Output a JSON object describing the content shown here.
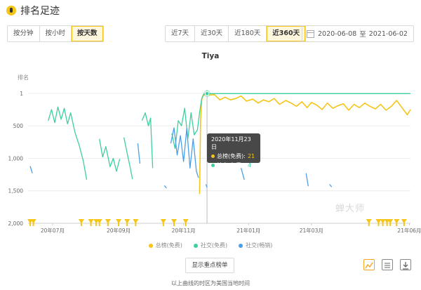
{
  "header": {
    "title": "排名足迹"
  },
  "granularity": {
    "options": [
      "按分钟",
      "按小时",
      "按天数"
    ],
    "active": 2
  },
  "ranges": {
    "options": [
      "近7天",
      "近30天",
      "近180天",
      "近360天"
    ],
    "active": 3
  },
  "date_range": {
    "start": "2020-06-08",
    "separator": "至",
    "end": "2021-06-02"
  },
  "tooltip": {
    "date": "2020年11月23日",
    "rows": [
      {
        "label": "总榜(免费):",
        "value": "21",
        "color": "#f5c518"
      },
      {
        "label": "社交(免费):",
        "value": "4",
        "color": "#3ecf9e"
      }
    ]
  },
  "show_button": "显示重点榜单",
  "footer": "以上曲线的时区为美国当地时间",
  "watermark": "蝉大师",
  "colors": {
    "total_free": "#f5c518",
    "social_free": "#3ecf9e",
    "social_paid": "#4a9fe8"
  },
  "chart_data": {
    "type": "line",
    "title": "Tiya",
    "ylabel": "排名",
    "y_ticks": [
      "1",
      "500",
      "1,000",
      "1,500",
      "2,000"
    ],
    "y_tick_values": [
      1,
      500,
      1000,
      1500,
      2000
    ],
    "ylim": [
      1,
      2000
    ],
    "y_inverted": true,
    "x_ticks": [
      "20年07月",
      "20年09月",
      "20年11月",
      "21年01月",
      "21年03月",
      "21年06月"
    ],
    "x_tick_dates": [
      "2020-07-01",
      "2020-09-01",
      "2020-11-01",
      "2021-01-01",
      "2021-03-01",
      "2021-06-01"
    ],
    "xlim": [
      "2020-06-08",
      "2021-06-02"
    ],
    "grid": true,
    "legend": "bottom",
    "series": [
      {
        "name": "总榜(免费)",
        "color": "#f5c518",
        "points": [
          [
            "2020-11-16",
            1550
          ],
          [
            "2020-11-17",
            400
          ],
          [
            "2020-11-18",
            100
          ],
          [
            "2020-11-19",
            40
          ],
          [
            "2020-11-21",
            20
          ],
          [
            "2020-11-23",
            21
          ],
          [
            "2020-11-26",
            25
          ],
          [
            "2020-11-30",
            20
          ],
          [
            "2020-12-05",
            100
          ],
          [
            "2020-12-10",
            60
          ],
          [
            "2020-12-15",
            100
          ],
          [
            "2020-12-20",
            80
          ],
          [
            "2020-12-25",
            40
          ],
          [
            "2020-12-30",
            120
          ],
          [
            "2021-01-05",
            90
          ],
          [
            "2021-01-10",
            150
          ],
          [
            "2021-01-15",
            100
          ],
          [
            "2021-01-20",
            130
          ],
          [
            "2021-01-25",
            80
          ],
          [
            "2021-01-30",
            170
          ],
          [
            "2021-02-05",
            110
          ],
          [
            "2021-02-10",
            150
          ],
          [
            "2021-02-15",
            200
          ],
          [
            "2021-02-20",
            130
          ],
          [
            "2021-02-25",
            220
          ],
          [
            "2021-03-01",
            140
          ],
          [
            "2021-03-06",
            180
          ],
          [
            "2021-03-11",
            250
          ],
          [
            "2021-03-16",
            150
          ],
          [
            "2021-03-21",
            230
          ],
          [
            "2021-03-26",
            190
          ],
          [
            "2021-03-31",
            160
          ],
          [
            "2021-04-05",
            260
          ],
          [
            "2021-04-10",
            170
          ],
          [
            "2021-04-15",
            220
          ],
          [
            "2021-04-20",
            150
          ],
          [
            "2021-04-25",
            200
          ],
          [
            "2021-04-30",
            240
          ],
          [
            "2021-05-05",
            170
          ],
          [
            "2021-05-10",
            260
          ],
          [
            "2021-05-15",
            200
          ],
          [
            "2021-05-20",
            110
          ],
          [
            "2021-05-25",
            220
          ],
          [
            "2021-05-30",
            330
          ],
          [
            "2021-06-02",
            250
          ]
        ]
      },
      {
        "name": "社交(免费)",
        "color": "#3ecf9e",
        "points": [
          [
            "2020-06-27",
            420
          ],
          [
            "2020-06-30",
            250
          ],
          [
            "2020-07-03",
            450
          ],
          [
            "2020-07-06",
            210
          ],
          [
            "2020-07-09",
            400
          ],
          [
            "2020-07-12",
            230
          ],
          [
            "2020-07-15",
            470
          ],
          [
            "2020-07-18",
            300
          ],
          [
            "2020-07-22",
            600
          ],
          [
            "2020-07-26",
            800
          ],
          [
            "2020-07-30",
            1050
          ],
          [
            "2020-08-02",
            1330
          ],
          null,
          [
            "2020-08-14",
            700
          ],
          [
            "2020-08-17",
            980
          ],
          [
            "2020-08-20",
            820
          ],
          [
            "2020-08-24",
            1130
          ],
          [
            "2020-08-27",
            1000
          ],
          [
            "2020-08-30",
            1200
          ],
          [
            "2020-09-02",
            1010
          ],
          null,
          [
            "2020-09-06",
            680
          ],
          [
            "2020-09-09",
            920
          ],
          [
            "2020-09-12",
            1150
          ],
          [
            "2020-09-14",
            1320
          ],
          null,
          [
            "2020-09-23",
            420
          ],
          [
            "2020-09-26",
            300
          ],
          [
            "2020-09-29",
            500
          ],
          [
            "2020-10-01",
            380
          ],
          [
            "2020-10-03",
            1150
          ],
          null,
          [
            "2020-10-21",
            620
          ],
          [
            "2020-10-24",
            850
          ],
          [
            "2020-10-27",
            420
          ],
          [
            "2020-10-30",
            500
          ],
          [
            "2020-11-02",
            230
          ],
          [
            "2020-11-05",
            700
          ],
          [
            "2020-11-08",
            300
          ],
          [
            "2020-11-11",
            640
          ],
          [
            "2020-11-14",
            560
          ],
          [
            "2020-11-16",
            300
          ],
          [
            "2020-11-18",
            80
          ],
          [
            "2020-11-20",
            10
          ],
          [
            "2020-11-23",
            4
          ],
          [
            "2020-12-15",
            4
          ],
          [
            "2021-01-15",
            4
          ],
          [
            "2021-02-15",
            4
          ],
          [
            "2021-03-15",
            4
          ],
          [
            "2021-04-15",
            4
          ],
          [
            "2021-05-15",
            4
          ],
          [
            "2021-06-02",
            4
          ]
        ]
      },
      {
        "name": "社交(畅销)",
        "color": "#4a9fe8",
        "points": [
          [
            "2020-06-10",
            1120
          ],
          [
            "2020-06-12",
            1230
          ],
          null,
          [
            "2020-09-19",
            770
          ],
          [
            "2020-09-21",
            1080
          ],
          null,
          [
            "2020-10-14",
            1420
          ],
          [
            "2020-10-16",
            1460
          ],
          null,
          [
            "2020-10-20",
            770
          ],
          [
            "2020-10-23",
            530
          ],
          [
            "2020-10-26",
            950
          ],
          [
            "2020-10-29",
            650
          ],
          [
            "2020-11-01",
            1050
          ],
          [
            "2020-11-04",
            540
          ],
          [
            "2020-11-07",
            1150
          ],
          [
            "2020-11-10",
            700
          ],
          [
            "2020-11-13",
            1200
          ],
          [
            "2020-11-15",
            1300
          ],
          null,
          [
            "2020-11-22",
            1400
          ],
          [
            "2020-11-23",
            1450
          ],
          null,
          [
            "2020-12-25",
            1150
          ],
          [
            "2020-12-28",
            1330
          ],
          null,
          [
            "2021-02-24",
            1230
          ],
          [
            "2021-02-26",
            1430
          ],
          null,
          [
            "2021-03-18",
            1400
          ],
          [
            "2021-03-20",
            1440
          ]
        ]
      }
    ],
    "markers": [
      "2020-06-10",
      "2020-06-13",
      "2020-07-28",
      "2020-08-06",
      "2020-08-11",
      "2020-08-14",
      "2020-08-22",
      "2020-09-01",
      "2020-09-09",
      "2020-09-17",
      "2020-10-13",
      "2020-10-23",
      "2020-11-03",
      "2021-04-24",
      "2021-05-03",
      "2021-05-07",
      "2021-05-11",
      "2021-05-14",
      "2021-05-20",
      "2021-05-27"
    ],
    "hover_date": "2020-11-23"
  }
}
